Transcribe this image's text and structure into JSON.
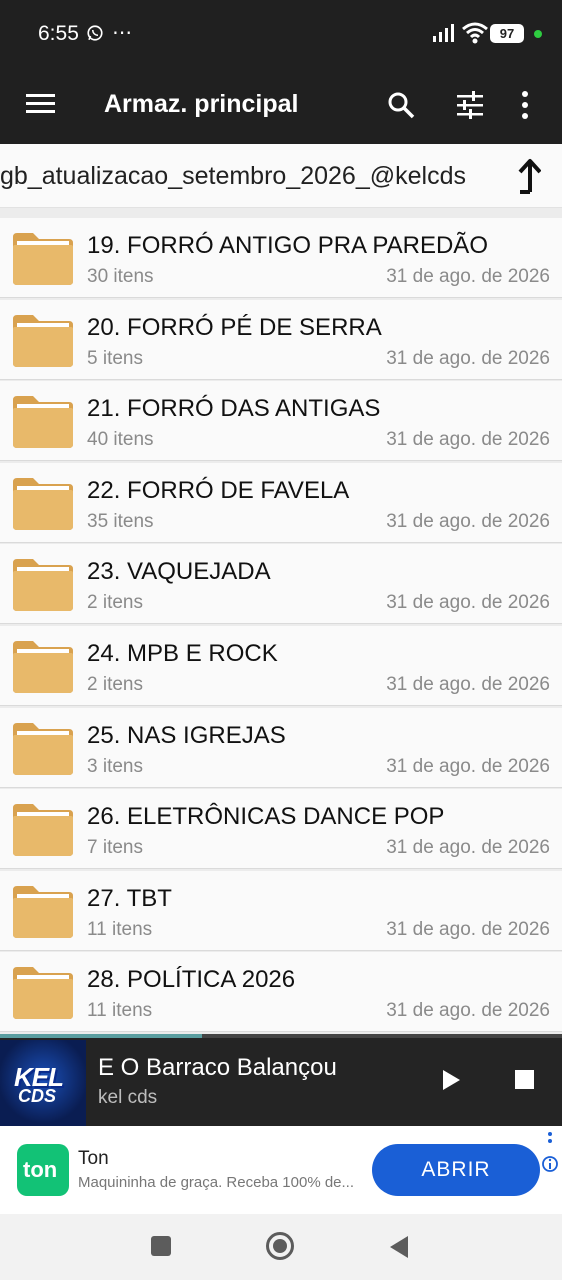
{
  "status_bar": {
    "time": "6:55",
    "dots": "⋯",
    "battery": "97"
  },
  "app_bar": {
    "title": "Armaz. principal",
    "icons": [
      "menu-icon",
      "search-icon",
      "tune-icon",
      "more-vert-icon"
    ]
  },
  "path": {
    "text": "gb_atualizacao_setembro_2026_@kelcds",
    "up_icon": "arrow-up-icon"
  },
  "folders": [
    {
      "name": "19. FORRÓ ANTIGO PRA PAREDÃO",
      "count": "30 itens",
      "date": "31 de ago. de 2026"
    },
    {
      "name": "20. FORRÓ PÉ DE SERRA",
      "count": "5 itens",
      "date": "31 de ago. de 2026"
    },
    {
      "name": "21. FORRÓ DAS ANTIGAS",
      "count": "40 itens",
      "date": "31 de ago. de 2026"
    },
    {
      "name": "22. FORRÓ DE FAVELA",
      "count": "35 itens",
      "date": "31 de ago. de 2026"
    },
    {
      "name": "23. VAQUEJADA",
      "count": "2 itens",
      "date": "31 de ago. de 2026"
    },
    {
      "name": "24. MPB E ROCK",
      "count": "2 itens",
      "date": "31 de ago. de 2026"
    },
    {
      "name": "25. NAS IGREJAS",
      "count": "3 itens",
      "date": "31 de ago. de 2026"
    },
    {
      "name": "26. ELETRÔNICAS DANCE POP",
      "count": "7 itens",
      "date": "31 de ago. de 2026"
    },
    {
      "name": "27. TBT",
      "count": "11 itens",
      "date": "31 de ago. de 2026"
    },
    {
      "name": "28. POLÍTICA 2026",
      "count": "11 itens",
      "date": "31 de ago. de 2026"
    }
  ],
  "player": {
    "title": "E O Barraco Balançou",
    "artist": "kel cds",
    "album_art_text_1": "KEL",
    "album_art_text_2": "CDS",
    "progress": 0.36
  },
  "ad": {
    "title": "Ton",
    "logo_text": "ton",
    "description": "Maquininha de graça. Receba 100% de...",
    "button": "ABRIR"
  },
  "colors": {
    "folder": "#e8b96a",
    "folder_dark": "#d9a24f",
    "bar_bg": "#202020",
    "ad_button": "#1a5fd6",
    "ton_green": "#12c276"
  }
}
